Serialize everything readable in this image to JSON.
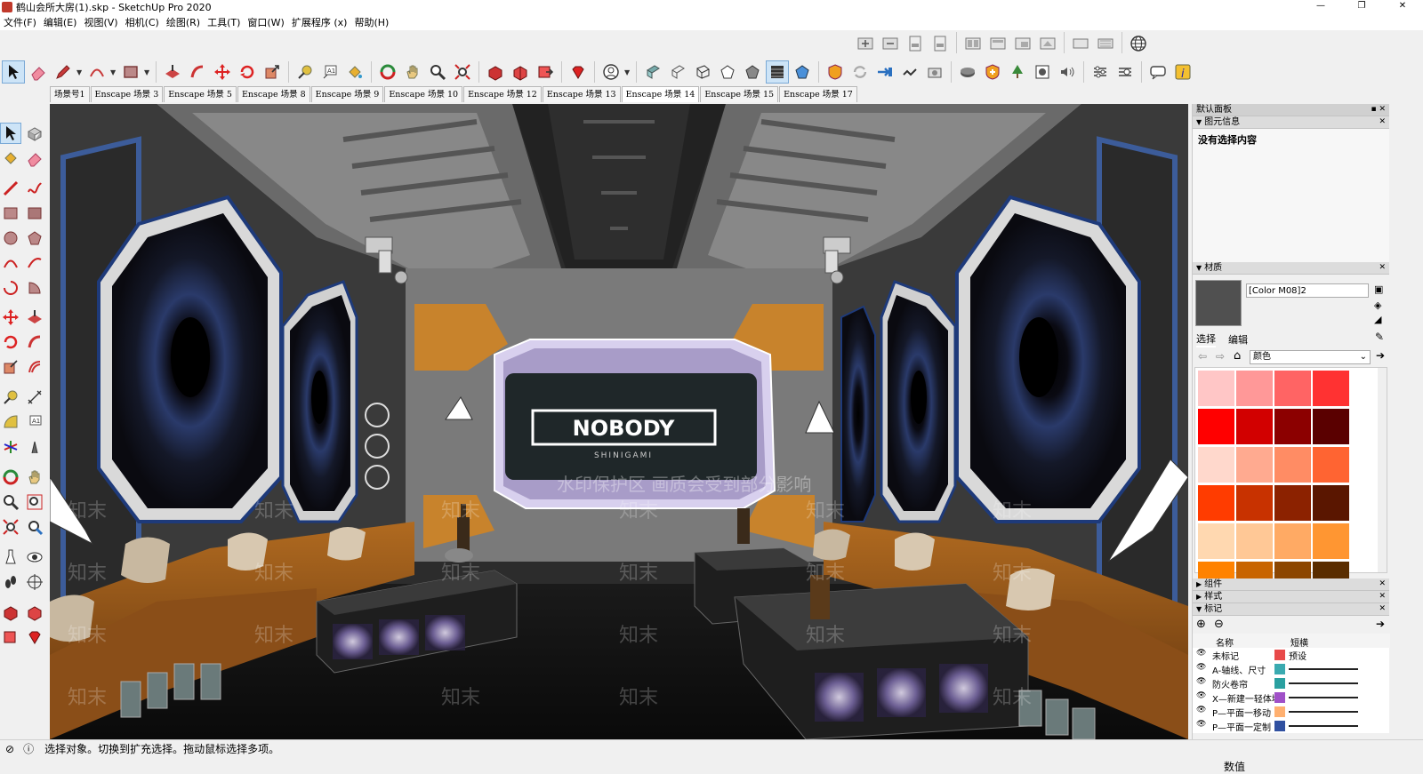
{
  "window": {
    "title": "鹤山会所大房(1).skp - SketchUp Pro 2020",
    "minimize": "—",
    "restore": "❐",
    "close": "✕"
  },
  "menu": [
    "文件(F)",
    "编辑(E)",
    "视图(V)",
    "相机(C)",
    "绘图(R)",
    "工具(T)",
    "窗口(W)",
    "扩展程序 (x)",
    "帮助(H)"
  ],
  "scenes": {
    "tabs": [
      "场景号1",
      "Enscape 场景 3",
      "Enscape 场景 5",
      "Enscape 场景 8",
      "Enscape 场景 9",
      "Enscape 场景 10",
      "Enscape 场景 12",
      "Enscape 场景 13",
      "Enscape 场景 14",
      "Enscape 场景 15",
      "Enscape 场景 17"
    ],
    "active_index": 8
  },
  "viewport": {
    "screen_text": "NOBODY",
    "screen_subtext": "SHINIGAMI",
    "watermark_main": "水印保护区  画质会受到部分影响",
    "watermark_tile": "知末"
  },
  "panel": {
    "default_tray": "默认面板",
    "entity_info": {
      "header": "图元信息",
      "empty_text": "没有选择内容"
    },
    "materials": {
      "header": "材质",
      "current_material": "[Color M08]2",
      "tab_select": "选择",
      "tab_edit": "编辑",
      "library": "颜色",
      "swatch_colors": [
        "#ffc6c6",
        "#ff9898",
        "#ff6464",
        "#ff3232",
        "#ff0000",
        "#d20000",
        "#8c0000",
        "#5a0000",
        "#ffd8cc",
        "#ffaa90",
        "#ff8c64",
        "#ff6432",
        "#ff3c00",
        "#c83200",
        "#8c2200",
        "#5a1600",
        "#ffd8b0",
        "#ffc896",
        "#ffaa64",
        "#ff9632",
        "#ff8200",
        "#c86400",
        "#8c4600",
        "#5a2d00"
      ]
    },
    "components_header": "组件",
    "styles_header": "样式",
    "tags": {
      "header": "标记",
      "col_name": "名称",
      "col_dash": "短横",
      "rows": [
        {
          "name": "未标记",
          "color": "#e84a4a",
          "dash": "预设"
        },
        {
          "name": "A-轴线、尺寸",
          "color": "#3aaab0",
          "dash": ""
        },
        {
          "name": "防火卷帘",
          "color": "#2aa0a0",
          "dash": ""
        },
        {
          "name": "X—新建一轻体墙",
          "color": "#a050c8",
          "dash": ""
        },
        {
          "name": "P—平面一移动",
          "color": "#ffb070",
          "dash": ""
        },
        {
          "name": "P—平面一定制",
          "color": "#3050a0",
          "dash": ""
        }
      ]
    }
  },
  "status": {
    "message": "选择对象。切换到扩充选择。拖动鼠标选择多项。",
    "measurements_label": "数值"
  }
}
